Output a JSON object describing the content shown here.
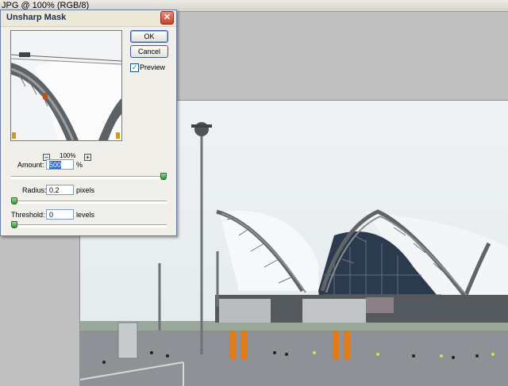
{
  "document": {
    "title": "JPG @ 100% (RGB/8)"
  },
  "dialog": {
    "title": "Unsharp Mask",
    "close_glyph": "✕",
    "ok_label": "OK",
    "cancel_label": "Cancel",
    "preview_label": "Preview",
    "preview_checked": true,
    "check_glyph": "✓",
    "zoom": {
      "minus": "−",
      "plus": "+",
      "value": "100%"
    },
    "amount": {
      "label": "Amount:",
      "value": "500",
      "unit": "%",
      "slider_fraction": 1.0
    },
    "radius": {
      "label": "Radius:",
      "value": "0.2",
      "unit": "pixels",
      "slider_fraction": 0.0
    },
    "threshold": {
      "label": "Threshold:",
      "value": "0",
      "unit": "levels",
      "slider_fraction": 0.0
    }
  },
  "colors": {
    "workspace": "#c0c0c0",
    "dialog_bg": "#f0efe9",
    "close_red": "#c2452f",
    "slider_green": "#2f8f35",
    "jet_bridge_orange": "#e07a1a"
  }
}
